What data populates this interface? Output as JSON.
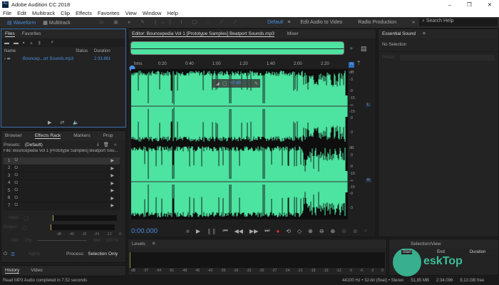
{
  "window": {
    "title": "Adobe Audition CC 2018",
    "min": "–",
    "max": "❐",
    "close": "✕"
  },
  "menu": [
    "File",
    "Edit",
    "Multitrack",
    "Clip",
    "Effects",
    "Favorites",
    "View",
    "Window",
    "Help"
  ],
  "toolbar": {
    "waveform": "Waveform",
    "multitrack": "Multitrack",
    "workspaces": [
      "Default",
      "Edit Audio to Video",
      "Radio Production"
    ],
    "more": "»",
    "search_placeholder": "Search Help"
  },
  "files": {
    "tabs": [
      "Files",
      "Favorites"
    ],
    "columns": [
      "Name",
      "Status",
      "Duration"
    ],
    "items": [
      {
        "name": "Bouncep...ort Sounds.mp3",
        "duration": "2:33.861"
      }
    ]
  },
  "effects": {
    "tabs": [
      "Browser",
      "Effects Rack",
      "Markers",
      "Prop"
    ],
    "presets_label": "Presets:",
    "preset": "(Default)",
    "file": "File: Bouncepedia Vol 1 [Prototype Samples] Beatport Sou...",
    "slots": [
      "1",
      "2",
      "3",
      "4",
      "5",
      "6",
      "7"
    ],
    "input": "Input:",
    "output": "Output:",
    "meter_ticks": [
      "dB",
      "-48",
      "-36",
      "-24",
      "-12",
      "0"
    ],
    "mix": "Mix:",
    "dry": "Dry",
    "wet": "Wet",
    "wet_pct": "100 %",
    "apply": "Apply",
    "process_label": "Process:",
    "process": "Selection Only"
  },
  "history": {
    "tabs": [
      "History",
      "Video"
    ],
    "message": "Read MP3 Audio completed in 7.52 seconds"
  },
  "editor": {
    "tabs": [
      "Editor: Bouncepedia Vol 1 [Prototype Samples] Beatport Sounds.mp3",
      "Mixer"
    ],
    "ruler": [
      "hms",
      "0:20",
      "0:40",
      "1:00",
      "1:20",
      "1:40",
      "2:00",
      "2:20"
    ],
    "hud_gain": "+0 dB",
    "db_scale": [
      "dB",
      "-3",
      "-9",
      "-15",
      "-∞",
      "-15",
      "-9",
      "-3"
    ],
    "channels": [
      "L",
      "R"
    ],
    "time": "0:00.000",
    "waveform_color": "#4de3a0"
  },
  "levels": {
    "title": "Levels",
    "ticks": [
      "dB",
      "-57",
      "-54",
      "-51",
      "-48",
      "-45",
      "-42",
      "-39",
      "-36",
      "-33",
      "-30",
      "-27",
      "-24",
      "-21",
      "-18",
      "-15",
      "-12",
      "-9",
      "-6",
      "-3",
      "0"
    ]
  },
  "essential": {
    "title": "Essential Sound",
    "no_selection": "No Selection",
    "preset": "Preset:"
  },
  "selection": {
    "title": "Selection/View",
    "cols": [
      "Start",
      "End",
      "Duration"
    ]
  },
  "status": {
    "format": "44100 Hz • 32-bit (float) • Stereo",
    "size": "51,85 MB",
    "duration": "2:34.096",
    "free": "9,13 GB free"
  },
  "watermark": "DeskTop FILECR .com"
}
